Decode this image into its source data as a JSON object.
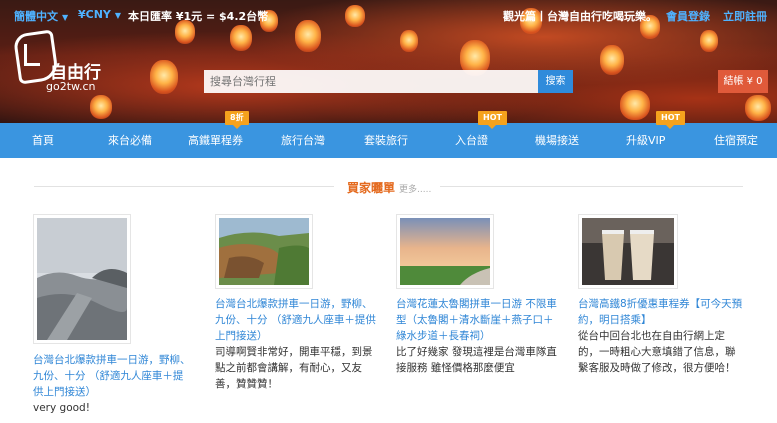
{
  "topbar": {
    "language": "簡體中文",
    "currency": "¥CNY",
    "rate": "本日匯率 ¥1元 = $4.2台幣",
    "slogan": "觀光篇丨台灣自由行吃喝玩樂。",
    "member_login": "會員登錄",
    "register": "立即註冊"
  },
  "logo": {
    "name": "自由行",
    "url": "go2tw.cn"
  },
  "search": {
    "placeholder": "搜尋台灣行程",
    "button": "搜索"
  },
  "cart": {
    "label": "結帳 ¥ 0"
  },
  "nav": {
    "items": [
      {
        "label": "首頁"
      },
      {
        "label": "來台必備"
      },
      {
        "label": "高鐵單程券",
        "badge": "8折"
      },
      {
        "label": "旅行台灣"
      },
      {
        "label": "套裝旅行"
      },
      {
        "label": "入台證",
        "badge": "HOT"
      },
      {
        "label": "機場接送"
      },
      {
        "label": "升級VIP",
        "badge": "HOT"
      },
      {
        "label": "住宿預定"
      }
    ]
  },
  "section": {
    "title": "買家曬單",
    "more": "更多....."
  },
  "cards": [
    {
      "title": "台灣台北爆款拼車一日游，野柳、九份、十分 （舒適九人座車＋提供上門接送）",
      "review": "very good!"
    },
    {
      "title": "台灣台北爆款拼車一日游，野柳、九份、十分 （舒適九人座車＋提供上門接送）",
      "review": "司導啊賢非常好，開車平穩，到景點之前都會講解，有耐心，又友善，贊贊贊！"
    },
    {
      "title": "台灣花蓮太魯閣拼車一日游 不限車型（太魯閣＋清水斷崖＋燕子口＋綠水步道＋長春祠）",
      "review": "比了好幾家 發現這裡是台灣車隊直接服務 雖怪價格那麼便宜"
    },
    {
      "title": "台灣高鐵8折優惠車程券【可今天預約，明日搭乘】",
      "review": "從台中回台北也在自由行網上定的，一時粗心大意填錯了信息，聯繫客服及時做了修改，很方便哈！"
    }
  ],
  "colors": {
    "nav_bg": "#3a95e0",
    "link": "#2f86d6",
    "accent": "#e46a1e",
    "badge": "#f5a21d",
    "cart": "#e05a3a"
  }
}
